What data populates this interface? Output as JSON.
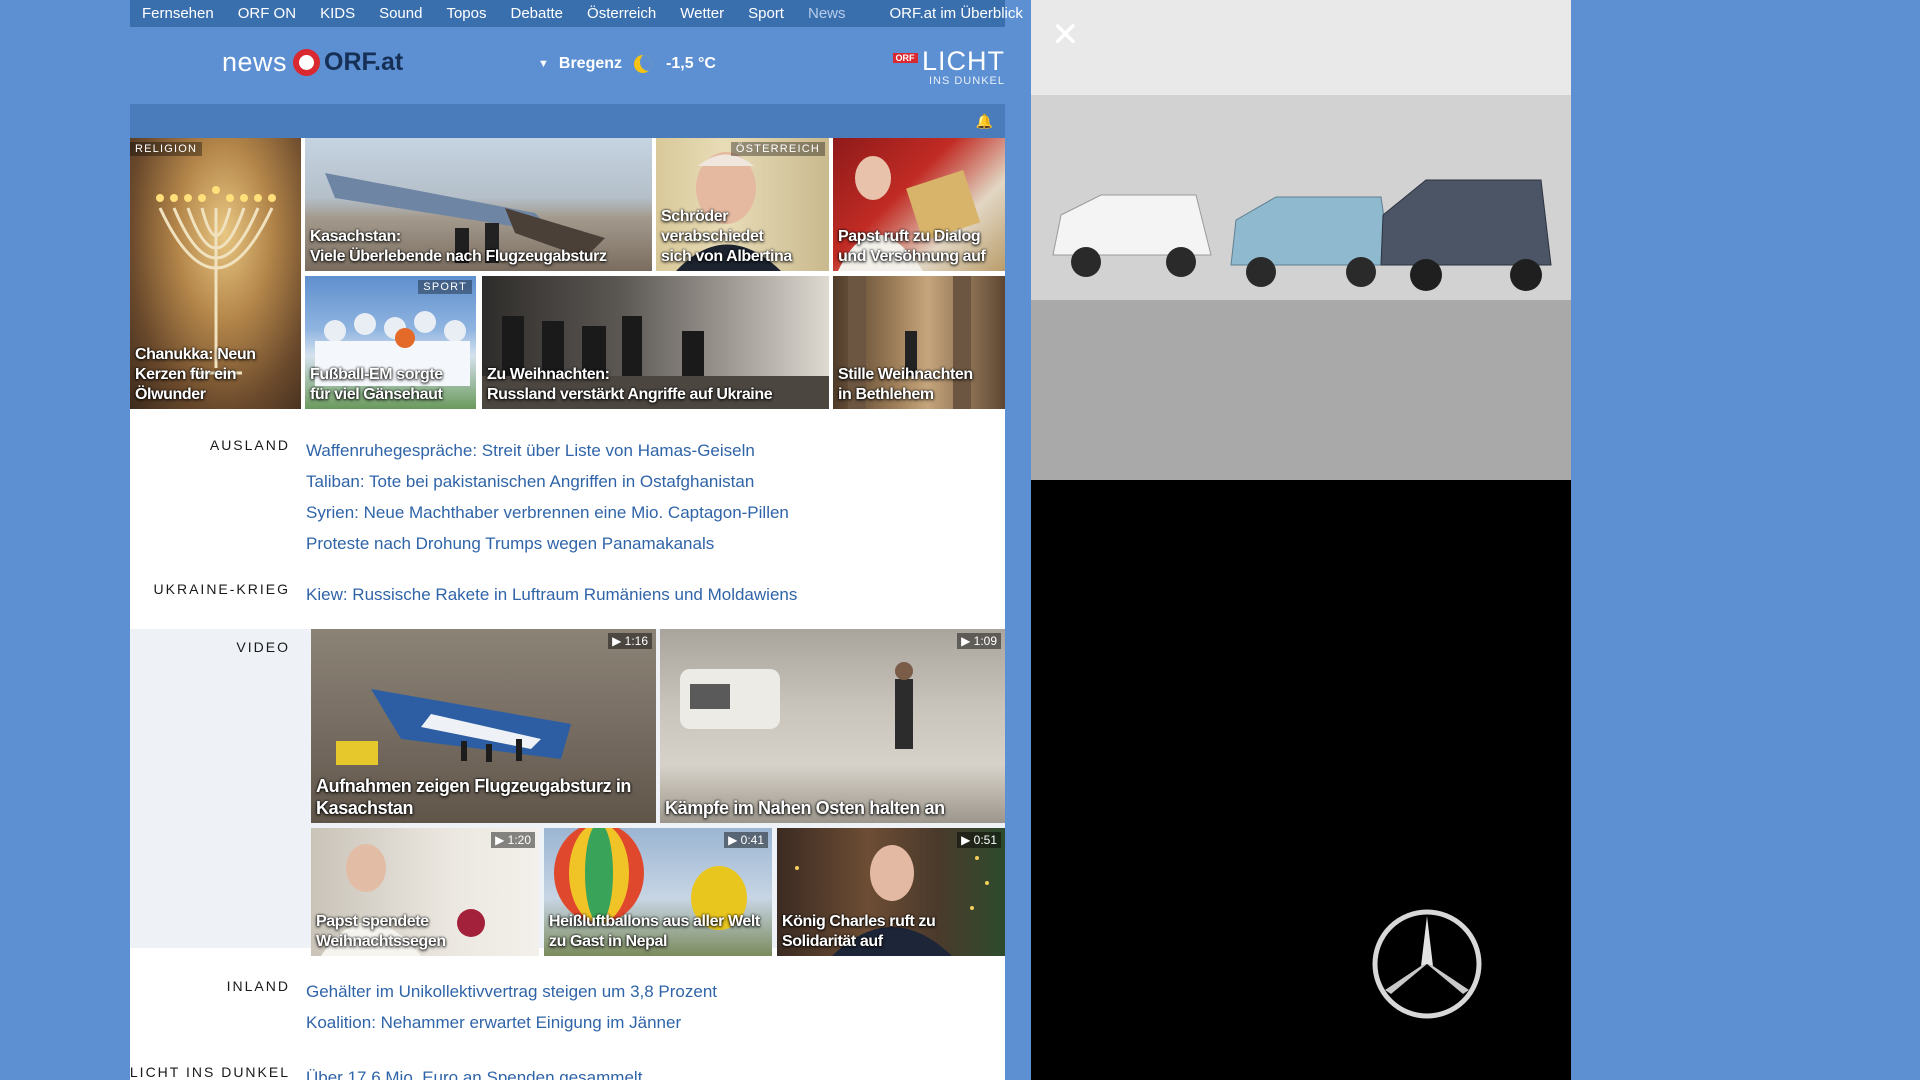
{
  "topnav": {
    "items": [
      "Fernsehen",
      "ORF ON",
      "KIDS",
      "Sound",
      "Topos",
      "Debatte",
      "Österreich",
      "Wetter",
      "Sport",
      "News"
    ],
    "overview": "ORF.at im Überblick"
  },
  "header": {
    "logo_news": "news",
    "logo_orf": "ORF.at",
    "weather": {
      "city": "Bregenz",
      "temp": "-1,5 °C"
    },
    "licht": {
      "badge": "ORF",
      "big": "LICHT",
      "small": "INS DUNKEL"
    }
  },
  "colors": {
    "background": "#5c90d2",
    "topnav": "#3a6fae",
    "link": "#2f64a8",
    "orf_red": "#d9282f"
  },
  "hero": [
    {
      "tag": "RELIGION",
      "caption": "Chanukka: Neun\nKerzen für ein Ölwunder"
    },
    {
      "tag": "",
      "caption": "Kasachstan:\nViele Überlebende nach Flugzeugabsturz"
    },
    {
      "tag": "ÖSTERREICH",
      "caption": "Schröder verabschiedet\nsich von Albertina"
    },
    {
      "tag": "",
      "caption": "Papst ruft zu Dialog\nund Versöhnung auf"
    },
    {
      "tag": "SPORT",
      "caption": "Fußball-EM sorgte\nfür viel Gänsehaut"
    },
    {
      "tag": "",
      "caption": "Zu Weihnachten:\nRussland verstärkt Angriffe auf Ukraine"
    },
    {
      "tag": "",
      "caption": "Stille Weihnachten\nin Bethlehem"
    }
  ],
  "sections": {
    "ausland": {
      "label": "AUSLAND",
      "links": [
        "Waffenruhegespräche: Streit über Liste von Hamas-Geiseln",
        "Taliban: Tote bei pakistanischen Angriffen in Ostafghanistan",
        "Syrien: Neue Machthaber verbrennen eine Mio. Captagon-Pillen",
        "Proteste nach Drohung Trumps wegen Panamakanals"
      ]
    },
    "ukraine": {
      "label": "UKRAINE-KRIEG",
      "links": [
        "Kiew: Russische Rakete in Luftraum Rumäniens und Moldawiens"
      ]
    },
    "inland": {
      "label": "INLAND",
      "links": [
        "Gehälter im Unikollektivvertrag steigen um 3,8 Prozent",
        "Koalition: Nehammer erwartet Einigung im Jänner"
      ]
    },
    "licht": {
      "label": "LICHT INS DUNKEL",
      "links": [
        "Über 17,6 Mio. Euro an Spenden gesammelt"
      ]
    }
  },
  "video": {
    "label": "VIDEO",
    "items": [
      {
        "duration": "1:16",
        "caption": "Aufnahmen zeigen Flugzeugabsturz in\nKasachstan"
      },
      {
        "duration": "1:09",
        "caption": "Kämpfe im Nahen Osten halten an"
      },
      {
        "duration": "1:20",
        "caption": "Papst spendete\nWeihnachtssegen"
      },
      {
        "duration": "0:41",
        "caption": "Heißluftballons aus aller Welt\nzu Gast in Nepal"
      },
      {
        "duration": "0:51",
        "caption": "König Charles ruft zu\nSolidarität auf"
      }
    ]
  },
  "ad": {
    "close_icon": "close-icon",
    "brand_icon": "mercedes-star-icon"
  }
}
